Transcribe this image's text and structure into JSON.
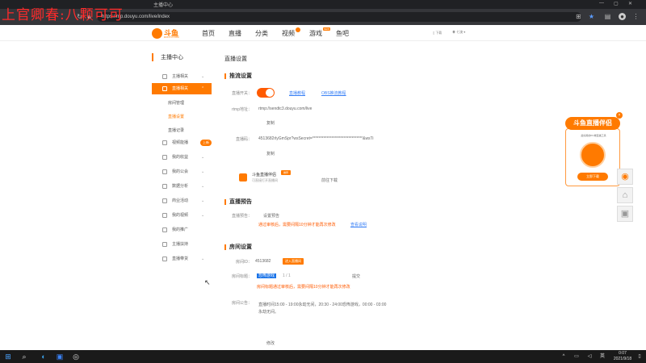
{
  "watermark": "上官卿春:八颗可可",
  "window": {
    "title": "主播中心"
  },
  "address": {
    "url": "https://mp.douyu.com/live/index"
  },
  "nav": {
    "logo_name": "斗鱼",
    "logo_sub": "DOUYU.COM",
    "links": [
      "首页",
      "直播",
      "分类",
      "视频",
      "游戏",
      "鱼吧"
    ],
    "video_badge": "",
    "game_tag": "NEW",
    "download_label": "下载",
    "user_label": "七澳"
  },
  "sidebar": {
    "title": "主播中心",
    "items": [
      {
        "label": "主播相关"
      },
      {
        "label": "直播相关"
      },
      {
        "label": "视频能播"
      },
      {
        "label": "我的收益"
      },
      {
        "label": "我的公会"
      },
      {
        "label": "数据分析"
      },
      {
        "label": "商业活动"
      },
      {
        "label": "我的视频"
      },
      {
        "label": "我的推广"
      },
      {
        "label": "主播扶持"
      },
      {
        "label": "直播带货"
      }
    ],
    "subitems": [
      "房间管理",
      "直播设置",
      "直播记录"
    ],
    "new_badge": "上新"
  },
  "main": {
    "page_title": "直播设置",
    "stream": {
      "section": "推流设置",
      "switch_label": "直播开关：",
      "tutorial": "直播教程",
      "third_party": "OBS推流教程",
      "rtmp_label": "rtmp地址：",
      "rtmp_value": "rtmp://sendtc3.douyu.com/live",
      "copy1": "复制",
      "code_label": "直播码：",
      "code_value": "4513682rlyGmSpr?wsSecret=********************************&wsTi",
      "copy2": "复制",
      "app_name": "斗鱼直播伴侣",
      "app_tag": "推荐",
      "app_desc": "可直接打开直播间",
      "app_download": "前往下载"
    },
    "notice": {
      "section": "直播预告",
      "label": "直播预告：",
      "set_link": "设置预告",
      "rule": "通过审核后，需要间隔10分钟才能再次修改",
      "view": "查看说明"
    },
    "room": {
      "section": "房间设置",
      "id_label": "房间ID：",
      "id_value": "4513682",
      "enter_btn": "进入直播间",
      "title_label": "房间标题：",
      "title_value": "恐怖游戏",
      "title_count": "1 / 1",
      "title_submit": "提交",
      "title_rule": "房间标题通过审核后，需要间隔10分钟才能再次修改",
      "announce_label": "房间公告：",
      "announce_line1": "直播时间15:00 - 19:00永劫无间，20:30 - 24:00恐怖游戏，00:00 - 03:00",
      "announce_line2": "永劫无间。",
      "modify": "修改"
    }
  },
  "promo": {
    "title": "斗鱼直播伴侣",
    "caption": "最好用的PC端直播工具",
    "download": "立即下载"
  },
  "taskbar": {
    "time": "0:07",
    "date": "2021/9/18"
  },
  "colors": {
    "accent": "#ff7a00",
    "link": "#3b82f6",
    "taskbar": "#1a1a1a"
  }
}
